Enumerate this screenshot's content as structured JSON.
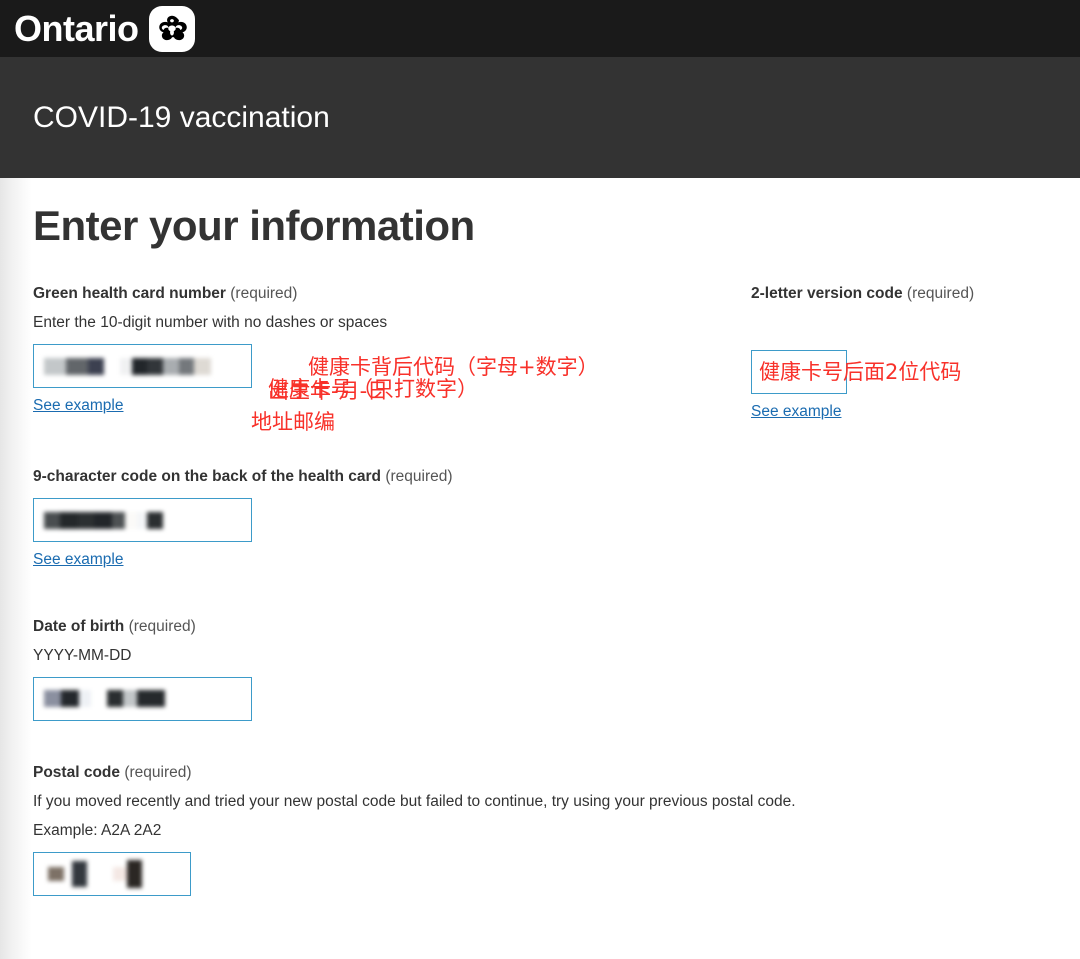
{
  "brand": {
    "word": "Ontario",
    "logo_icon": "ontario-trillium-logo"
  },
  "header": {
    "app_title": "COVID-19 vaccination"
  },
  "page": {
    "title": "Enter your information"
  },
  "colors": {
    "brandbar_bg": "#1a1a1a",
    "titleband_bg": "#333333",
    "input_border": "#3d9bc9",
    "link": "#1a6bb0",
    "annotation_red": "#f8312a",
    "text": "#333333"
  },
  "fields": {
    "health_card": {
      "label": "Green health card number",
      "required_text": "(required)",
      "hint": "Enter the 10-digit number with no dashes or spaces",
      "value": "",
      "link_label": "See example",
      "annotation": "健康卡号（只打数字）"
    },
    "version_code": {
      "label": "2-letter version code",
      "required_text": "(required)",
      "value": "",
      "link_label": "See example",
      "annotation": "健康卡号后面2位代码"
    },
    "back_code": {
      "label": "9-character code on the back of the health card",
      "required_text": "(required)",
      "value": "",
      "link_label": "See example",
      "annotation": "健康卡背后代码（字母+数字）"
    },
    "date_of_birth": {
      "label": "Date of birth",
      "required_text": "(required)",
      "hint": "YYYY-MM-DD",
      "value": "",
      "annotation": "出生年-月-日"
    },
    "postal_code": {
      "label": "Postal code",
      "required_text": "(required)",
      "hint": "If you moved recently and tried your new postal code but failed to continue, try using your previous postal code.",
      "example": "Example: A2A 2A2",
      "value": "",
      "annotation": "地址邮编"
    }
  }
}
